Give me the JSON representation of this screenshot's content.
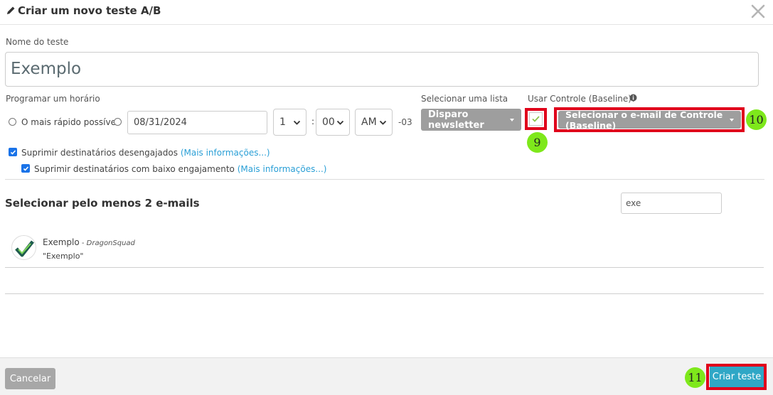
{
  "header": {
    "title": "Criar um novo teste A/B"
  },
  "form": {
    "name_label": "Nome do teste",
    "name_value": "Exemplo",
    "schedule_label": "Programar um horário",
    "asap_label": "O mais rápido possível",
    "date_value": "08/31/2024",
    "hour_value": "1",
    "time_separator": ":",
    "minute_value": "00",
    "ampm_value": "AM",
    "timezone": "-03",
    "list_label": "Selecionar uma lista",
    "list_value": "Disparo newsletter",
    "control_label": "Usar Controle (Baseline)?",
    "control_email_button": "Selecionar o e-mail de Controle (Baseline)",
    "suppress_disengaged": "Suprimir destinatários desengajados",
    "suppress_low_engagement": "Suprimir destinatários com baixo engajamento",
    "more_info": "(Mais informações...)"
  },
  "annotations": {
    "step_9": "9",
    "step_10": "10",
    "step_11": "11",
    "highlight_color": "#e0001b",
    "badge_color": "#7ee81b"
  },
  "emails": {
    "section_title": "Selecionar pelo menos 2 e-mails",
    "search_value": "exe",
    "items": [
      {
        "name": "Exemplo",
        "separator": " - ",
        "brand": "DragonSquad",
        "subject": "\"Exemplo\""
      }
    ]
  },
  "footer": {
    "cancel_label": "Cancelar",
    "create_label": "Criar teste",
    "accent_color": "#2fa7c6"
  }
}
